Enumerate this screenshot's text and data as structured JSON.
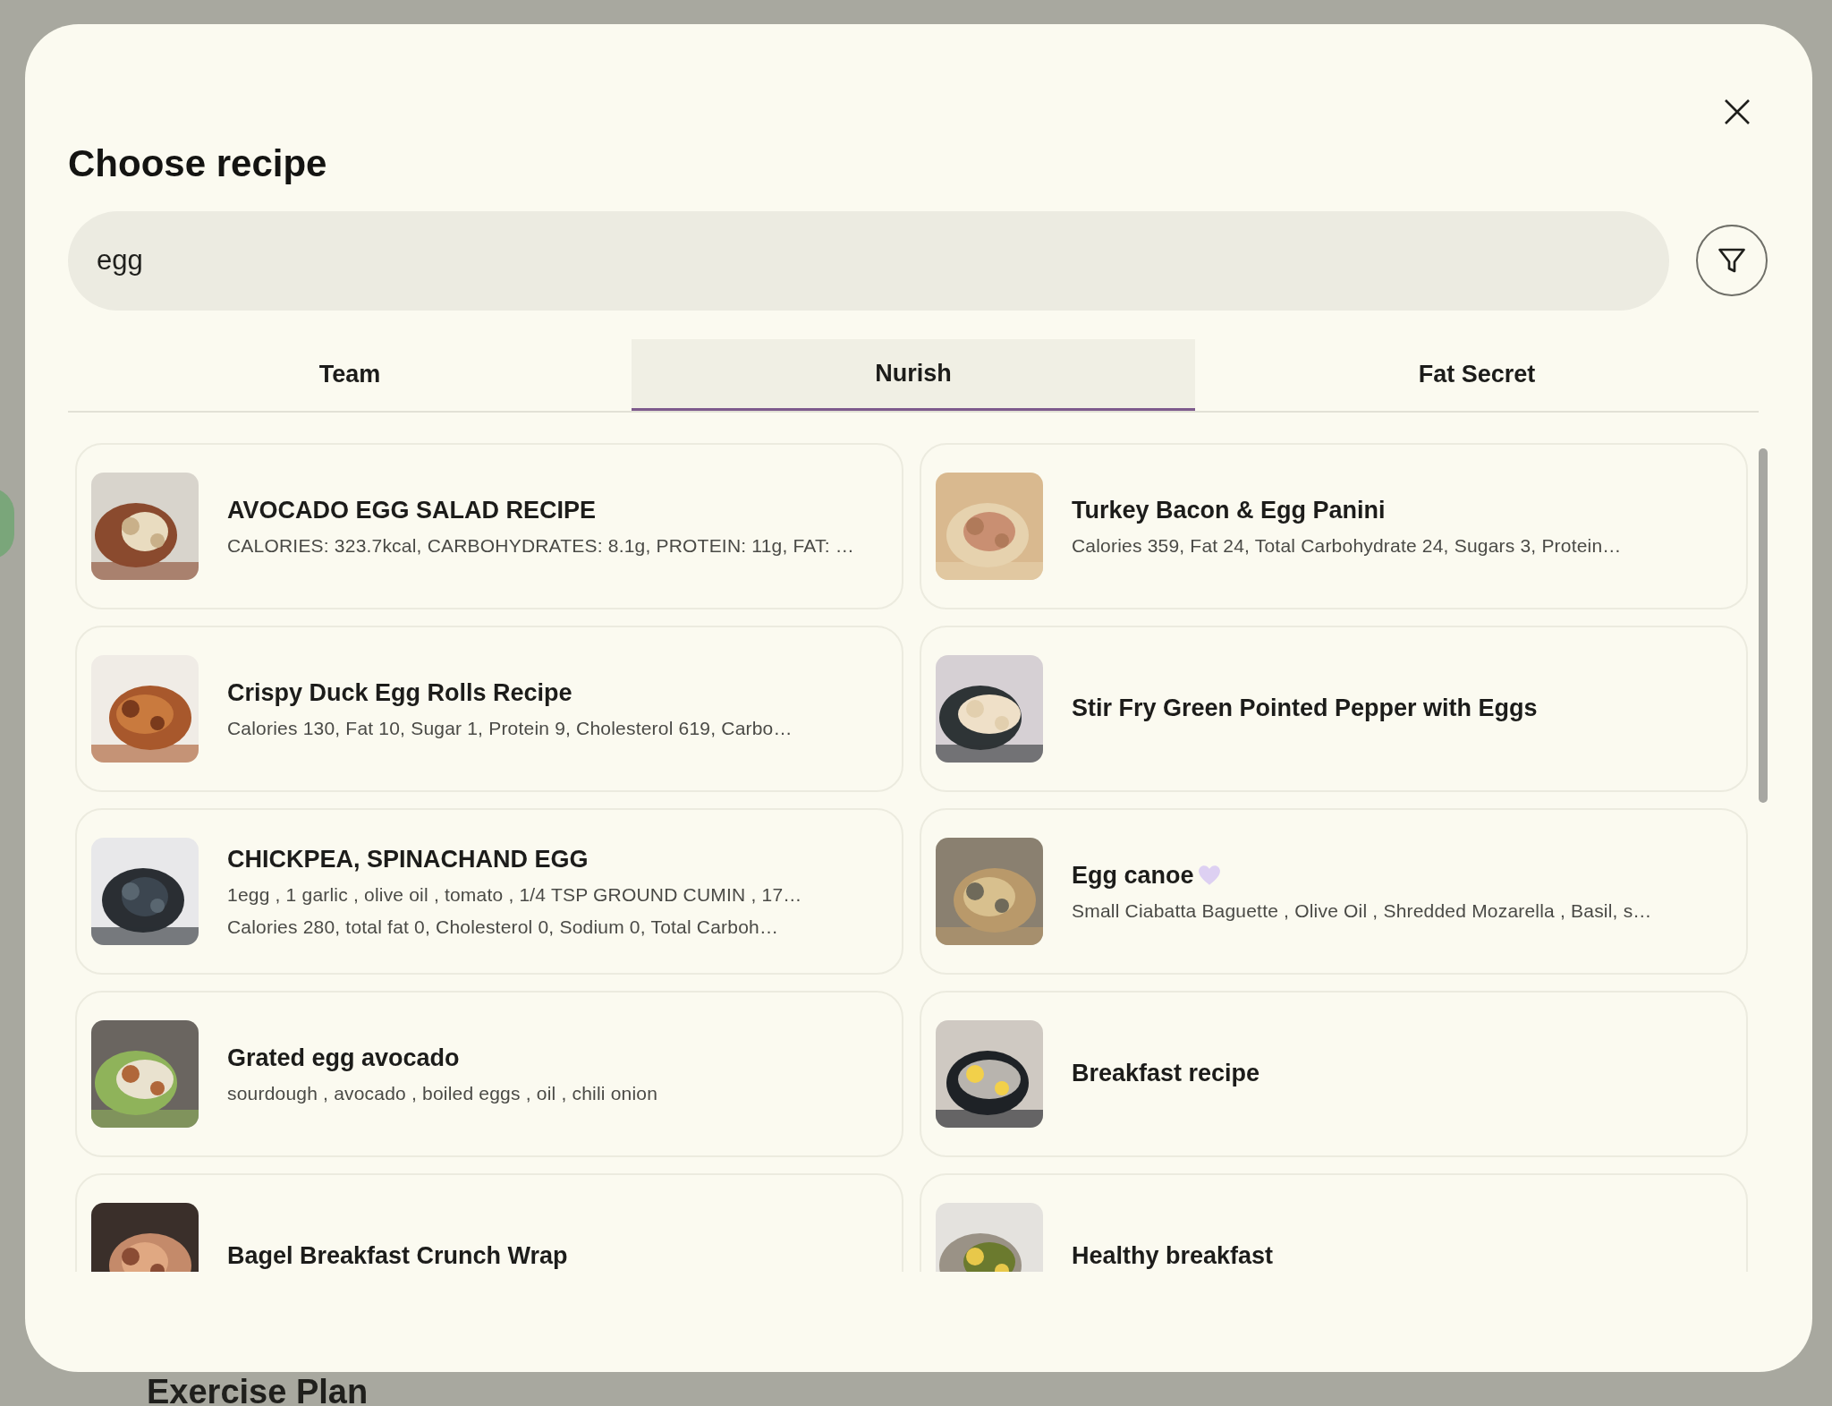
{
  "background": {
    "section_title": "Exercise Plan"
  },
  "dialog": {
    "title": "Choose recipe",
    "search": {
      "value": "egg"
    },
    "tabs": [
      {
        "label": "Team",
        "selected": false
      },
      {
        "label": "Nurish",
        "selected": true
      },
      {
        "label": "Fat Secret",
        "selected": false
      }
    ],
    "recipes": [
      {
        "title": "AVOCADO EGG SALAD RECIPE",
        "details": [
          "CALORIES: 323.7kcal, CARBOHYDRATES: 8.1g, PROTEIN: 11g, FAT: …"
        ]
      },
      {
        "title": "Turkey Bacon & Egg Panini",
        "details": [
          "Calories 359, Fat 24, Total Carbohydrate 24, Sugars  3, Protein…"
        ]
      },
      {
        "title": "Crispy Duck Egg Rolls Recipe",
        "details": [
          "Calories 130, Fat 10, Sugar 1, Protein 9, Cholesterol 619, Carbo…"
        ]
      },
      {
        "title": "Stir Fry Green Pointed Pepper with Eggs"
      },
      {
        "title": "CHICKPEA, SPINACHAND EGG",
        "details": [
          "1egg , 1 garlic , olive oil , tomato , 1/4 TSP GROUND CUMIN , 17…",
          "Calories 280, total fat 0, Cholesterol 0, Sodium 0, Total Carboh…"
        ]
      },
      {
        "title": "Egg canoe",
        "favorite": true,
        "details": [
          "Small Ciabatta Baguette , Olive Oil , Shredded Mozarella , Basil, s…"
        ]
      },
      {
        "title": "Grated egg avocado",
        "details": [
          "sourdough , avocado , boiled eggs , oil , chili onion"
        ]
      },
      {
        "title": "Breakfast recipe"
      },
      {
        "title": "Bagel Breakfast Crunch Wrap"
      },
      {
        "title": "Healthy breakfast"
      }
    ]
  }
}
